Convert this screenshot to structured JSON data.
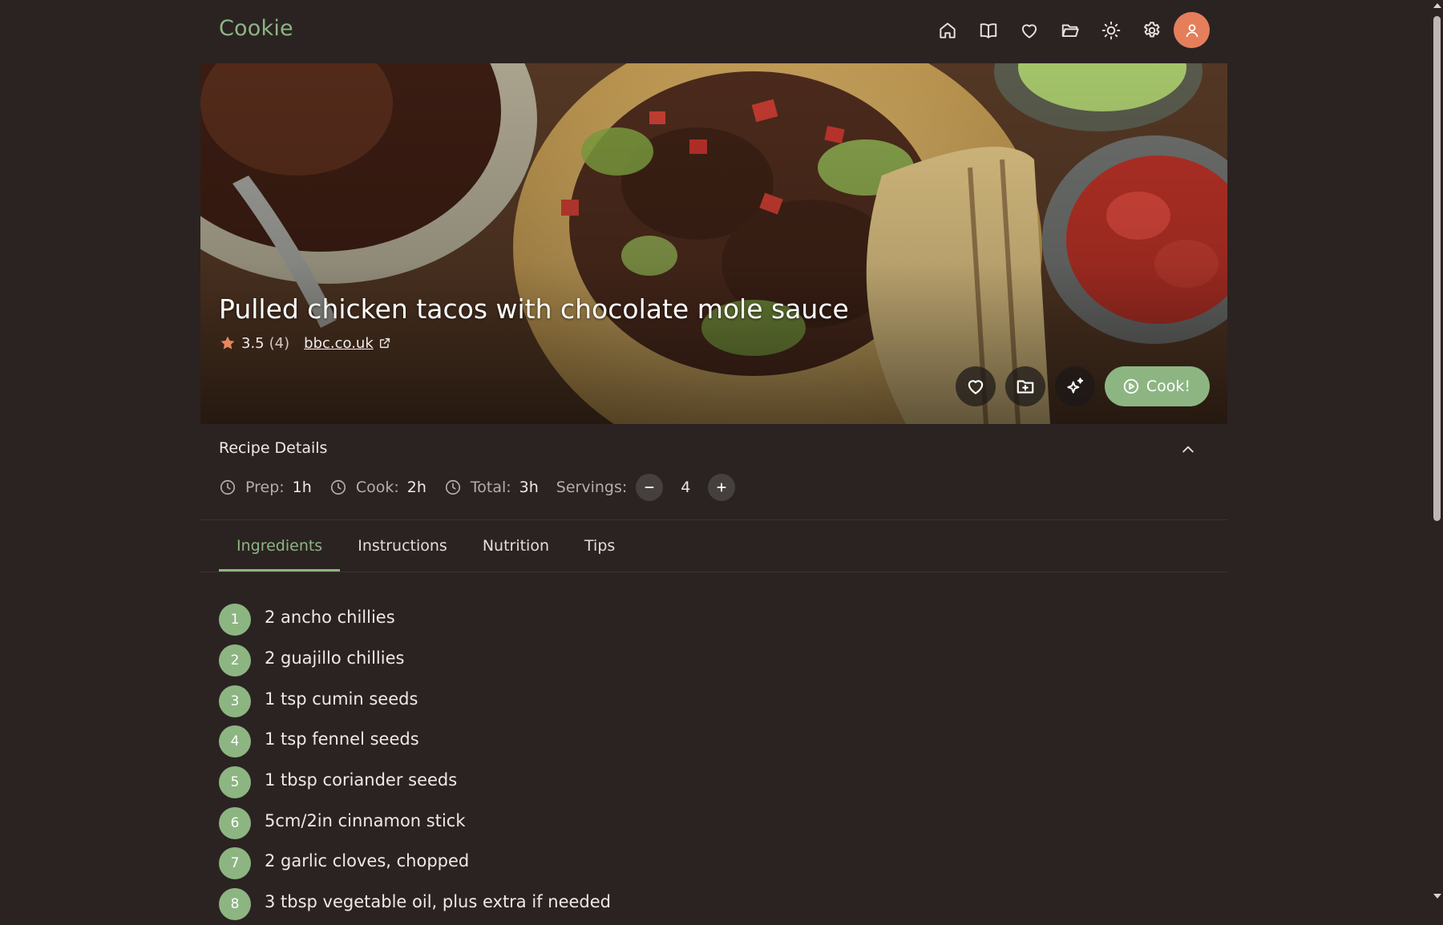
{
  "app": {
    "title": "Cookie"
  },
  "nav": {
    "icons": [
      "home-icon",
      "book-icon",
      "heart-icon",
      "folder-icon",
      "sun-icon",
      "gear-icon"
    ],
    "avatar_icon": "user-icon"
  },
  "recipe": {
    "title": "Pulled chicken tacos with chocolate mole sauce",
    "rating": "3.5",
    "rating_count": "(4)",
    "source": "bbc.co.uk",
    "cook_button": "Cook!"
  },
  "details": {
    "title": "Recipe Details",
    "prep_label": "Prep:",
    "prep_value": "1h",
    "cook_label": "Cook:",
    "cook_value": "2h",
    "total_label": "Total:",
    "total_value": "3h",
    "servings_label": "Servings:",
    "servings_value": "4"
  },
  "tabs": [
    "Ingredients",
    "Instructions",
    "Nutrition",
    "Tips"
  ],
  "active_tab": "Ingredients",
  "ingredients": [
    {
      "n": "1",
      "text": "2 ancho chillies"
    },
    {
      "n": "2",
      "text": "2 guajillo chillies"
    },
    {
      "n": "3",
      "text": "1 tsp cumin seeds"
    },
    {
      "n": "4",
      "text": "1 tsp fennel seeds"
    },
    {
      "n": "5",
      "text": "1 tbsp coriander seeds"
    },
    {
      "n": "6",
      "text": "5cm/2in cinnamon stick"
    },
    {
      "n": "7",
      "text": "2 garlic cloves, chopped"
    },
    {
      "n": "8",
      "text": "3 tbsp vegetable oil, plus extra if needed"
    }
  ],
  "colors": {
    "background": "#2a2322",
    "accent": "#8db582",
    "avatar": "#e57e5a",
    "star": "#e8875f"
  }
}
